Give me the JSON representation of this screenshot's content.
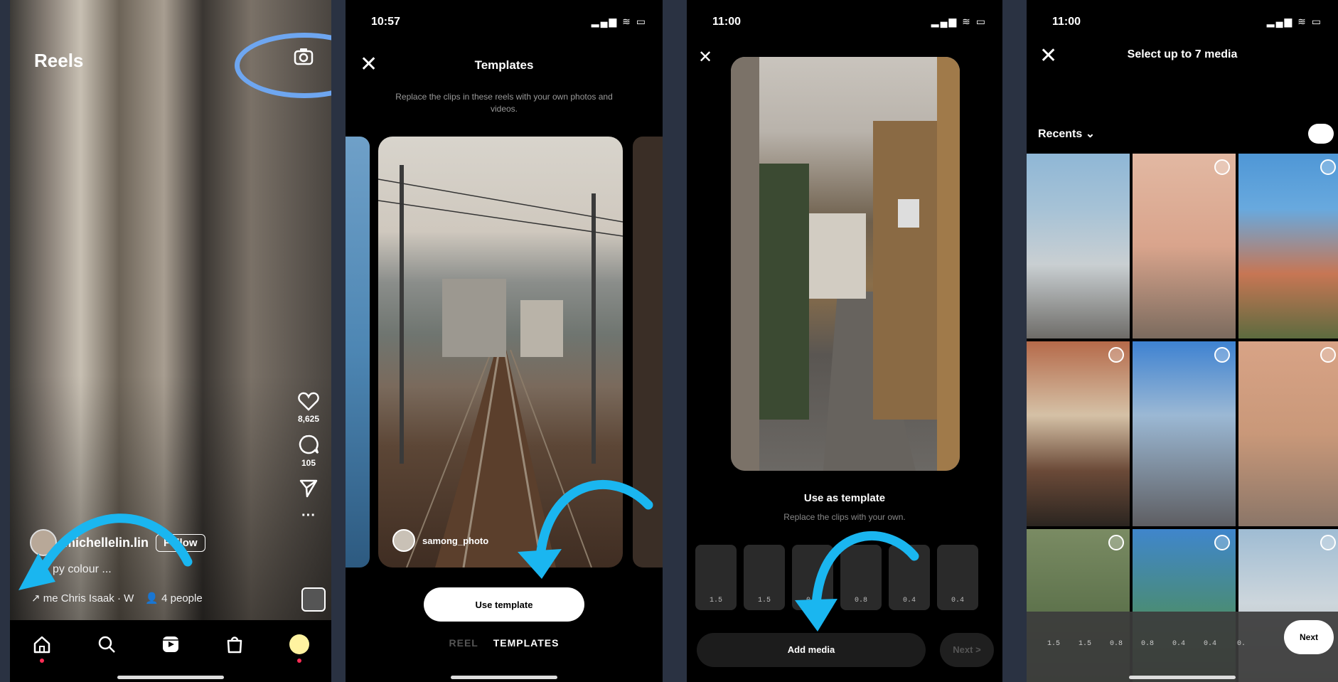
{
  "panel1": {
    "title": "Reels",
    "likes": "8,625",
    "comments": "105",
    "username": "michellelin.lin",
    "follow_label": "Follow",
    "caption": "py colour ...",
    "audio": "me Chris Isaak · W",
    "people": "4 people"
  },
  "panel2": {
    "time": "10:57",
    "title": "Templates",
    "subtitle": "Replace the clips in these reels with your own photos and videos.",
    "creator": "samong_photo",
    "use_template_label": "Use template",
    "tab_reel": "REEL",
    "tab_templates": "TEMPLATES"
  },
  "panel3": {
    "time": "11:00",
    "heading": "Use as template",
    "subheading": "Replace the clips with your own.",
    "clips": [
      "1.5",
      "1.5",
      "0.8",
      "0.8",
      "0.4",
      "0.4"
    ],
    "add_media_label": "Add media",
    "next_label": "Next >"
  },
  "panel4": {
    "time": "11:00",
    "title": "Select up to 7 media",
    "recents_label": "Recents",
    "clips": [
      "1.5",
      "1.5",
      "0.8",
      "0.8",
      "0.4",
      "0.4",
      "0."
    ],
    "next_label": "Next"
  },
  "colors": {
    "arrow_cyan": "#1ab6f0",
    "highlight_oval": "#6ea6f0",
    "accent_red": "#ff2d55"
  }
}
